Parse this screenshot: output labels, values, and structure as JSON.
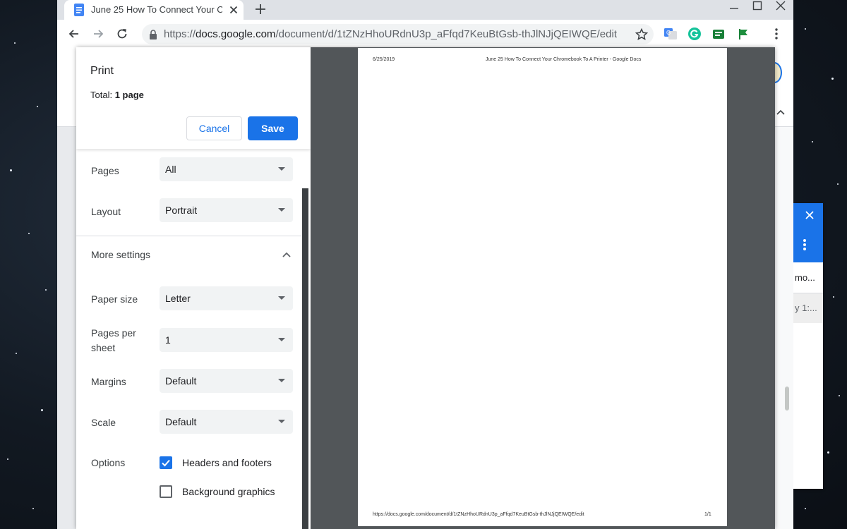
{
  "browser": {
    "tab_title": "June 25 How To Connect Your C",
    "url_scheme": "https://",
    "url_host": "docs.google.com",
    "url_path": "/document/d/1tZNzHhoURdnU3p_aFfqd7KeuBtGsb-thJlNJjQEIWQE/edit",
    "icons": [
      "docs-favicon",
      "close-icon",
      "plus-icon",
      "minimize-icon",
      "maximize-icon",
      "close-window-icon",
      "back-icon",
      "forward-icon",
      "reload-icon",
      "lock-icon",
      "star-icon",
      "translate-icon",
      "grammarly-icon",
      "extension-icon",
      "flag-icon",
      "menu-icon"
    ]
  },
  "print_dialog": {
    "title": "Print",
    "total_label": "Total: ",
    "total_value": "1 page",
    "cancel_label": "Cancel",
    "save_label": "Save",
    "settings": {
      "pages": {
        "label": "Pages",
        "value": "All"
      },
      "layout": {
        "label": "Layout",
        "value": "Portrait"
      },
      "more_settings": "More settings",
      "paper_size": {
        "label": "Paper size",
        "value": "Letter"
      },
      "pages_per_sheet": {
        "label_line1": "Pages per",
        "label_line2": "sheet",
        "value": "1"
      },
      "margins": {
        "label": "Margins",
        "value": "Default"
      },
      "scale": {
        "label": "Scale",
        "value": "Default"
      },
      "options": {
        "label": "Options",
        "headers_footers": {
          "label": "Headers and footers",
          "checked": true
        },
        "background_graphics": {
          "label": "Background graphics",
          "checked": false
        }
      }
    }
  },
  "preview": {
    "header_date": "6/25/2019",
    "header_title": "June 25 How To Connect Your Chromebook To A Printer - Google Docs",
    "footer_url": "https://docs.google.com/document/d/1tZNzHhoURdnU3p_aFfqd7KeuBtGsb-thJlNJjQEIWQE/edit",
    "footer_page": "1/1"
  },
  "side_panel": {
    "item1": "mo...",
    "item2": "y 1:..."
  },
  "colors": {
    "accent": "#1a73e8",
    "preview_bg": "#525659",
    "tabstrip": "#dee1e6"
  }
}
